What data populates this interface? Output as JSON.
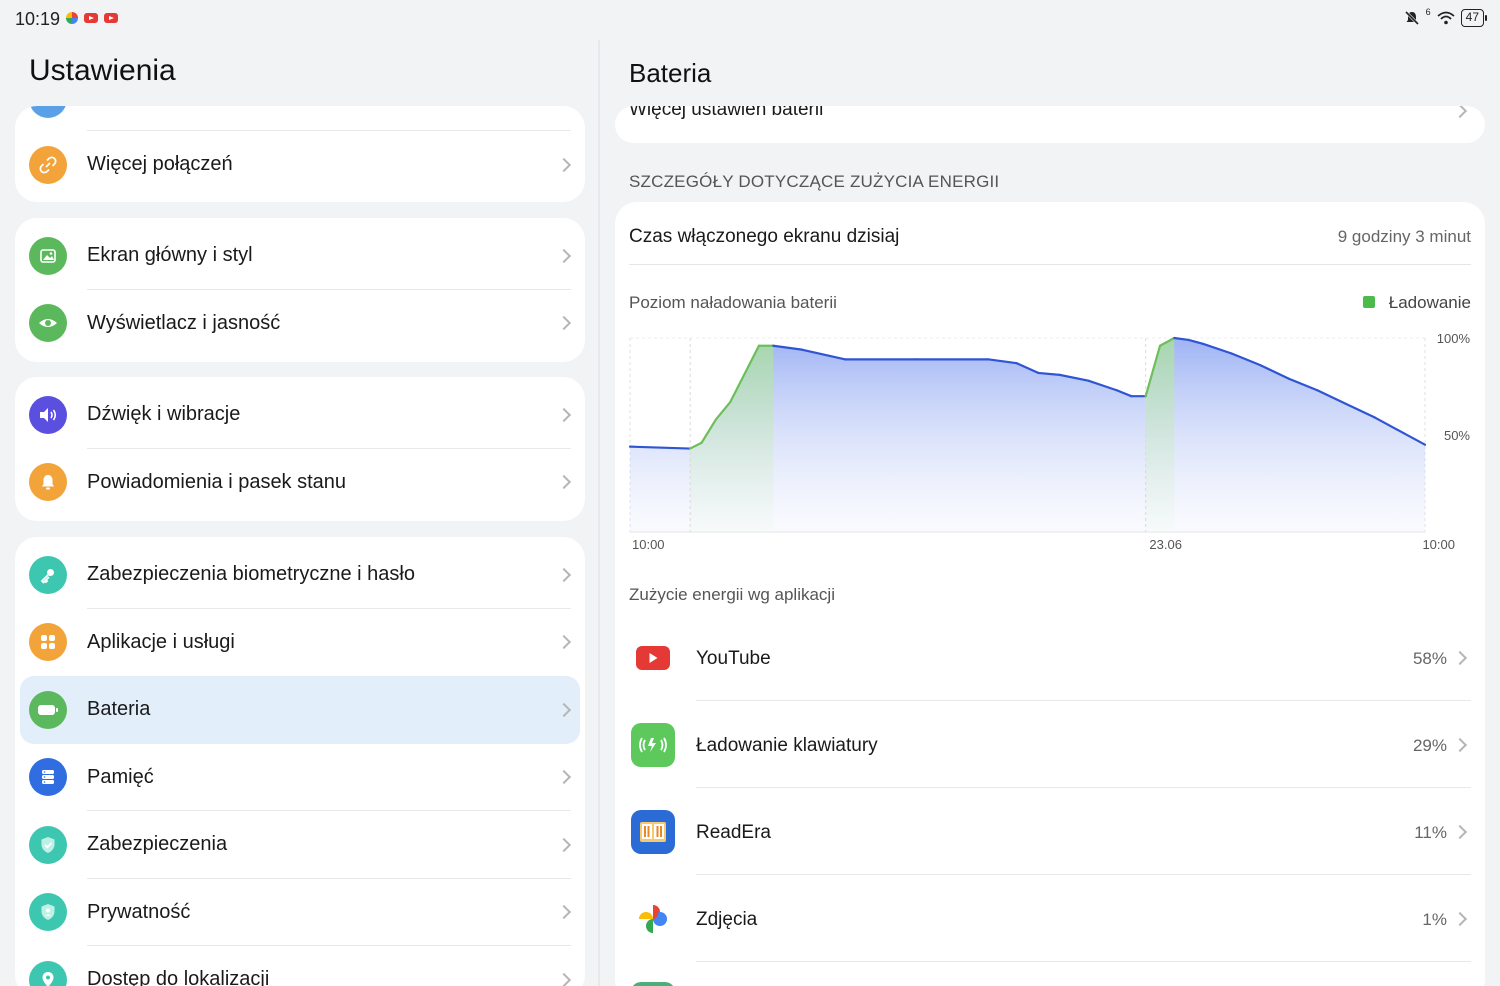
{
  "status_bar": {
    "time": "10:19",
    "battery": "47",
    "signal_superscript": "6"
  },
  "left": {
    "title": "Ustawienia",
    "items": [
      {
        "label": "Więcej połączeń",
        "icon": "link-icon",
        "color": "#f2a33a"
      },
      {
        "label": "Ekran główny i styl",
        "icon": "image-icon",
        "color": "#5cb85c"
      },
      {
        "label": "Wyświetlacz i jasność",
        "icon": "eye-icon",
        "color": "#5cb85c"
      },
      {
        "label": "Dźwięk i wibracje",
        "icon": "speaker-icon",
        "color": "#5b4fe0"
      },
      {
        "label": "Powiadomienia i pasek stanu",
        "icon": "bell-icon",
        "color": "#f2a33a"
      },
      {
        "label": "Zabezpieczenia biometryczne i hasło",
        "icon": "key-icon",
        "color": "#3ec7b0"
      },
      {
        "label": "Aplikacje i usługi",
        "icon": "apps-grid-icon",
        "color": "#f2a33a"
      },
      {
        "label": "Bateria",
        "icon": "battery-icon",
        "color": "#5cb85c"
      },
      {
        "label": "Pamięć",
        "icon": "storage-icon",
        "color": "#2f6de0"
      },
      {
        "label": "Zabezpieczenia",
        "icon": "shield-check-icon",
        "color": "#3ec7b0"
      },
      {
        "label": "Prywatność",
        "icon": "privacy-shield-icon",
        "color": "#3ec7b0"
      },
      {
        "label": "Dostęp do lokalizacji",
        "icon": "location-pin-icon",
        "color": "#3ec7b0"
      }
    ]
  },
  "right": {
    "title": "Bateria",
    "more_settings": "Więcej ustawień baterii",
    "section_header": "SZCZEGÓŁY DOTYCZĄCE ZUŻYCIA ENERGII",
    "screen_time_label": "Czas włączonego ekranu dzisiaj",
    "screen_time_value": "9 godziny 3 minut",
    "chart_title": "Poziom naładowania baterii",
    "legend_charging": "Ładowanie",
    "app_usage_title": "Zużycie energii wg aplikacji",
    "apps": [
      {
        "name": "YouTube",
        "percent": "58%",
        "icon": "youtube-icon"
      },
      {
        "name": "Ładowanie klawiatury",
        "percent": "29%",
        "icon": "wireless-charging-icon"
      },
      {
        "name": "ReadEra",
        "percent": "11%",
        "icon": "book-icon"
      },
      {
        "name": "Zdjęcia",
        "percent": "1%",
        "icon": "pinwheel-icon"
      }
    ]
  },
  "chart_data": {
    "type": "area",
    "title": "Poziom naładowania baterii",
    "x_ticks": [
      "10:00",
      "23.06",
      "10:00"
    ],
    "y_ticks": [
      "100%",
      "50%"
    ],
    "ylim": [
      0,
      100
    ],
    "legend": "top-right",
    "colors": {
      "discharge": "#2f55d4",
      "charging": "#6cbf5a"
    },
    "series": [
      {
        "name": "Ładowanie",
        "segments": [
          {
            "points": [
              [
                4,
                43
              ],
              [
                5,
                45
              ],
              [
                6.6,
                62
              ],
              [
                8.9,
                97
              ],
              [
                10,
                97
              ]
            ]
          },
          {
            "points": [
              [
                0.464,
                70
              ],
              [
                0.47,
                97
              ],
              [
                0.48,
                100
              ]
            ],
            "unit": "fraction"
          }
        ]
      }
    ],
    "points": [
      [
        0,
        44
      ],
      [
        4.2,
        43
      ],
      [
        5.0,
        46
      ],
      [
        6.0,
        58
      ],
      [
        7.0,
        67
      ],
      [
        9.0,
        96
      ],
      [
        10.0,
        96
      ],
      [
        12.0,
        94
      ],
      [
        15.0,
        89
      ],
      [
        20.0,
        89
      ],
      [
        25.0,
        89
      ],
      [
        27.0,
        87
      ],
      [
        28.5,
        82
      ],
      [
        30.0,
        81
      ],
      [
        32.0,
        78
      ],
      [
        34.0,
        73
      ],
      [
        35.0,
        70
      ],
      [
        36.0,
        70
      ],
      [
        37.0,
        96
      ],
      [
        38.0,
        100
      ],
      [
        39.0,
        99
      ],
      [
        40.0,
        97
      ],
      [
        42.0,
        92
      ],
      [
        44.0,
        86
      ],
      [
        46.0,
        79
      ],
      [
        48.0,
        73
      ],
      [
        50.0,
        66
      ],
      [
        52.0,
        59
      ],
      [
        54.0,
        51
      ],
      [
        55.5,
        45
      ]
    ],
    "charging_ranges": [
      [
        4.2,
        10.0
      ],
      [
        36.0,
        38.0
      ]
    ]
  }
}
